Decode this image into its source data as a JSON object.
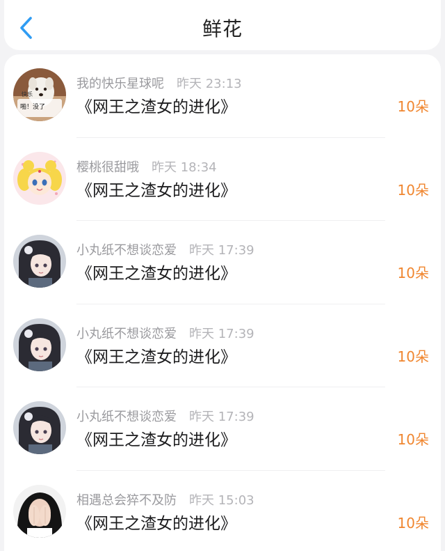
{
  "header": {
    "title": "鲜花"
  },
  "colors": {
    "accent_blue": "#2f9cf3",
    "amount_orange": "#f0862f",
    "text_primary": "#1c1c1e",
    "text_secondary": "#9a9a9e",
    "background": "#f3f3f5"
  },
  "rows": [
    {
      "name": "我的快乐星球呢",
      "time": "昨天 23:13",
      "book": "《网王之渣女的进化》",
      "amount": "10朵",
      "avatar_icon": "dog-meme-avatar",
      "avatar_text": [
        "快乐",
        "啪！没了"
      ]
    },
    {
      "name": "樱桃很甜哦",
      "time": "昨天 18:34",
      "book": "《网王之渣女的进化》",
      "amount": "10朵",
      "avatar_icon": "sailor-moon-avatar"
    },
    {
      "name": "小丸纸不想谈恋爱",
      "time": "昨天 17:39",
      "book": "《网王之渣女的进化》",
      "amount": "10朵",
      "avatar_icon": "anime-girl-avatar"
    },
    {
      "name": "小丸纸不想谈恋爱",
      "time": "昨天 17:39",
      "book": "《网王之渣女的进化》",
      "amount": "10朵",
      "avatar_icon": "anime-girl-avatar"
    },
    {
      "name": "小丸纸不想谈恋爱",
      "time": "昨天 17:39",
      "book": "《网王之渣女的进化》",
      "amount": "10朵",
      "avatar_icon": "anime-girl-avatar"
    },
    {
      "name": "相遇总会猝不及防",
      "time": "昨天 15:03",
      "book": "《网王之渣女的进化》",
      "amount": "10朵",
      "avatar_icon": "girl-covering-face-avatar"
    }
  ]
}
